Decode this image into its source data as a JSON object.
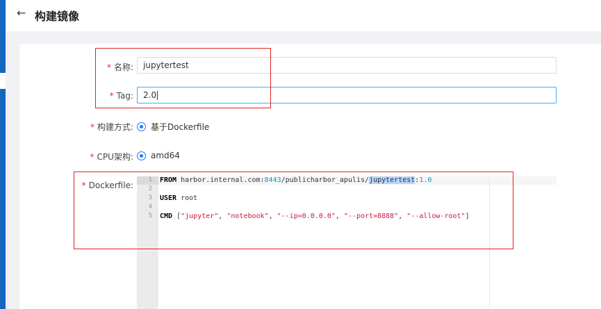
{
  "header": {
    "back_icon": "←",
    "title": "构建镜像"
  },
  "form": {
    "name": {
      "required": "*",
      "label": "名称:",
      "value": "jupytertest"
    },
    "tag": {
      "required": "*",
      "label": "Tag:",
      "value": "2.0"
    },
    "build_method": {
      "required": "*",
      "label": "构建方式:",
      "option": "基于Dockerfile"
    },
    "cpu_arch": {
      "required": "*",
      "label": "CPU架构:",
      "option": "amd64"
    },
    "dockerfile": {
      "required": "*",
      "label": "Dockerfile:"
    }
  },
  "editor": {
    "line_numbers": [
      "1",
      "2",
      "3",
      "4",
      "5"
    ],
    "line1": {
      "kw": "FROM",
      "a": " harbor.internal.com:",
      "port": "8443",
      "b": "/publicharbor_apulis/",
      "hl": "jupytertest",
      "c": ":",
      "ver": "1.0"
    },
    "line3": {
      "kw": "USER",
      "rest": " root"
    },
    "line5": {
      "kw": "CMD",
      "open": " [",
      "s1": "\"jupyter\"",
      "s2": "\"notebook\"",
      "s3": "\"--ip=0.0.0.0\"",
      "s4": "\"--port=8888\"",
      "s5": "\"--allow-root\"",
      "sep": ", ",
      "close": "]"
    }
  },
  "colors": {
    "accent": "#1677ff",
    "annotation": "#e02020",
    "sidebar": "#1665c1"
  }
}
